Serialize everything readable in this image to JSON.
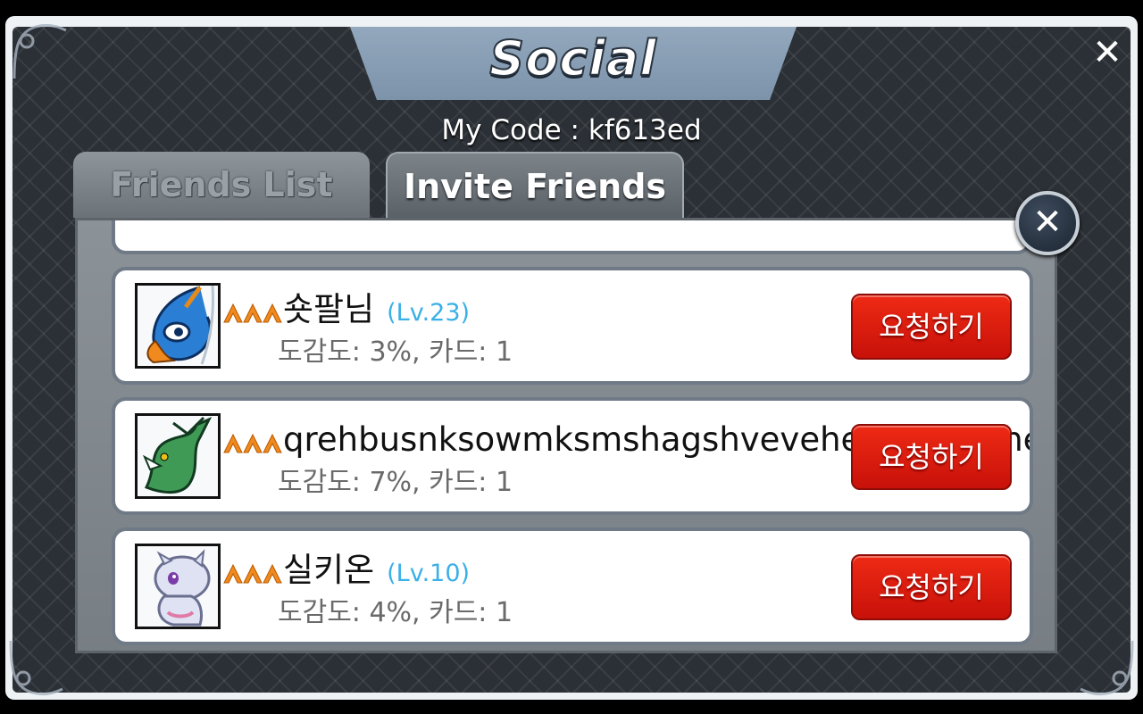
{
  "header": {
    "title": "Social",
    "my_code_label": "My Code : kf613ed"
  },
  "tabs": [
    {
      "label": "Friends List",
      "active": false
    },
    {
      "label": "Invite Friends",
      "active": true
    }
  ],
  "friends": [
    {
      "name": "숏팔님",
      "level": "(Lv.23)",
      "stats": "도감도: 3%, 카드: 1",
      "button": "요청하기",
      "avatar_icon": "blue-dragon-monster-icon"
    },
    {
      "name": "qrehbusnksowmksmshagshveveheneheshehe",
      "level": "",
      "stats": "도감도: 7%, 카드: 1",
      "button": "요청하기",
      "avatar_icon": "green-serpent-dragon-icon"
    },
    {
      "name": "실키온",
      "level": "(Lv.10)",
      "stats": "도감도: 4%, 카드: 1",
      "button": "요청하기",
      "avatar_icon": "white-purple-creature-icon"
    }
  ],
  "colors": {
    "request_button": "#d9190e",
    "level_text": "#3ab0e8",
    "rank_chevrons": "#f08a1e",
    "panel_background": "#2b3036"
  }
}
